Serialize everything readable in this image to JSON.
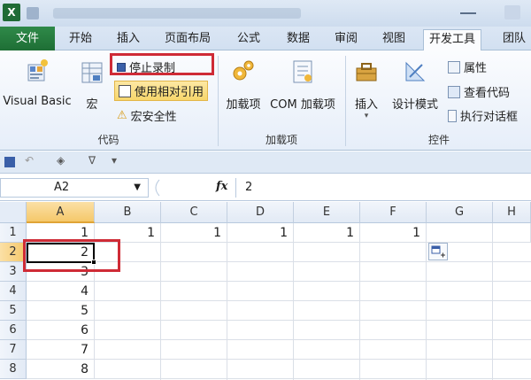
{
  "tabs": [
    {
      "label": "文件",
      "kind": "file"
    },
    {
      "label": "开始"
    },
    {
      "label": "插入"
    },
    {
      "label": "页面布局"
    },
    {
      "label": "公式"
    },
    {
      "label": "数据"
    },
    {
      "label": "审阅"
    },
    {
      "label": "视图"
    },
    {
      "label": "开发工具",
      "active": true
    },
    {
      "label": "团队"
    }
  ],
  "ribbon": {
    "code": {
      "label": "代码",
      "visual_basic": "Visual Basic",
      "macros": "宏",
      "stop_recording": "停止录制",
      "use_relative": "使用相对引用",
      "macro_security": "宏安全性"
    },
    "addins": {
      "label": "加载项",
      "addins": "加载项",
      "com_addins": "COM 加载项"
    },
    "controls": {
      "label": "控件",
      "insert": "插入",
      "design_mode": "设计模式",
      "properties": "属性",
      "view_code": "查看代码",
      "run_dialog": "执行对话框"
    }
  },
  "formula_bar": {
    "name_box": "A2",
    "fx": "fx",
    "content": "2"
  },
  "grid": {
    "columns": [
      "A",
      "B",
      "C",
      "D",
      "E",
      "F",
      "G",
      "H"
    ],
    "rows": [
      "1",
      "2",
      "3",
      "4",
      "5",
      "6",
      "7",
      "8"
    ],
    "active_cell": "A2",
    "cells": {
      "A1": "1",
      "B1": "1",
      "C1": "1",
      "D1": "1",
      "E1": "1",
      "F1": "1",
      "A2": "2",
      "A3": "3",
      "A4": "4",
      "A5": "5",
      "A6": "6",
      "A7": "7",
      "A8": "8"
    }
  },
  "colors": {
    "file_tab": "#1e6e35",
    "highlight_box": "#cf2b36",
    "selection_header": "#f5c86a"
  }
}
